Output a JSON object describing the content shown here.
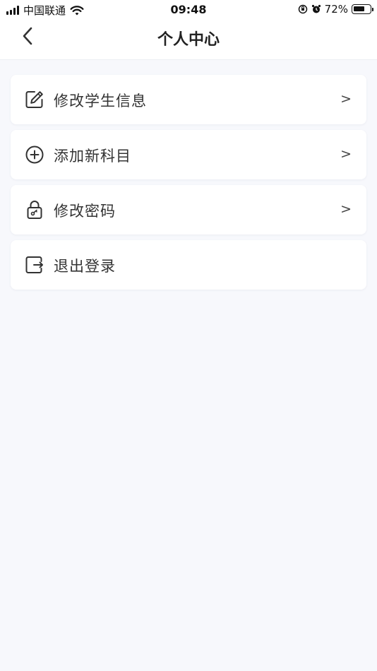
{
  "status_bar": {
    "carrier": "中国联通",
    "time": "09:48",
    "battery_percent": "72%",
    "battery_level": 0.72,
    "icons": [
      "signal-icon",
      "wifi-icon",
      "orientation-lock-icon",
      "alarm-icon",
      "battery-icon"
    ]
  },
  "navbar": {
    "title": "个人中心",
    "back_icon": "chevron-left-icon"
  },
  "menu": {
    "items": [
      {
        "label": "修改学生信息",
        "icon": "edit-icon",
        "chevron": ">"
      },
      {
        "label": "添加新科目",
        "icon": "add-circle-icon",
        "chevron": ">"
      },
      {
        "label": "修改密码",
        "icon": "lock-icon",
        "chevron": ">"
      },
      {
        "label": "退出登录",
        "icon": "logout-icon",
        "chevron": ""
      }
    ]
  },
  "colors": {
    "page_background": "#f7f8fc",
    "card_background": "#ffffff",
    "text": "#333333",
    "icon": "#333333"
  }
}
